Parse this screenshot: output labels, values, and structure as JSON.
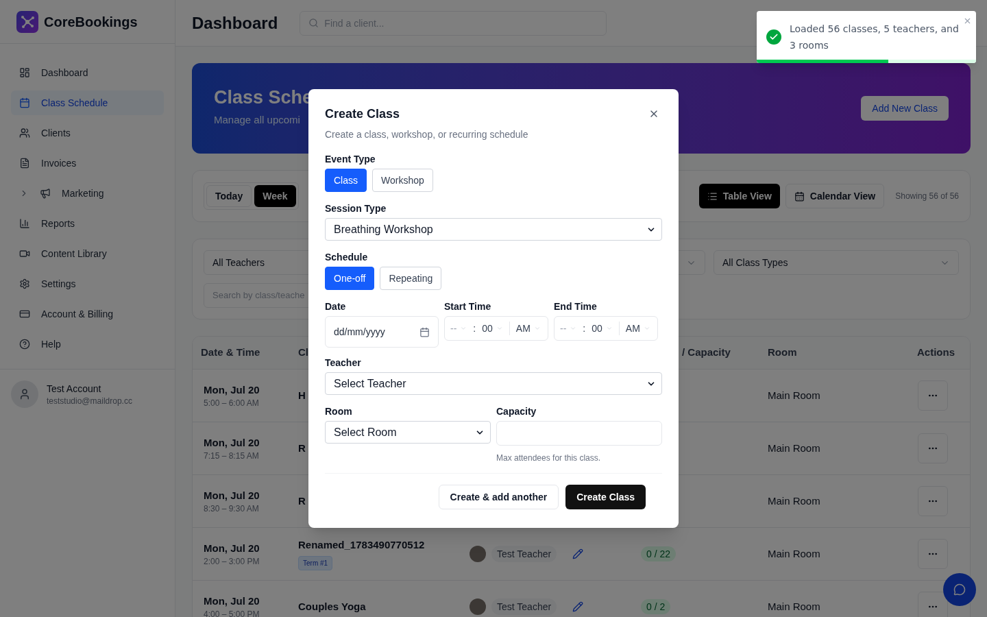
{
  "app": {
    "name": "CoreBookings"
  },
  "sidebar": {
    "items": [
      {
        "label": "Dashboard",
        "selected": false,
        "expandable": false
      },
      {
        "label": "Class Schedule",
        "selected": true,
        "expandable": false
      },
      {
        "label": "Clients",
        "selected": false,
        "expandable": false
      },
      {
        "label": "Invoices",
        "selected": false,
        "expandable": false
      },
      {
        "label": "Marketing",
        "selected": false,
        "expandable": true
      },
      {
        "label": "Reports",
        "selected": false,
        "expandable": false
      },
      {
        "label": "Content Library",
        "selected": false,
        "expandable": false
      },
      {
        "label": "Settings",
        "selected": false,
        "expandable": false
      },
      {
        "label": "Account & Billing",
        "selected": false,
        "expandable": false
      },
      {
        "label": "Help",
        "selected": false,
        "expandable": false
      }
    ],
    "user": {
      "name": "Test Account",
      "email": "teststudio@maildrop.cc"
    }
  },
  "header": {
    "title": "Dashboard",
    "search": {
      "placeholder": "Find a client..."
    }
  },
  "banner": {
    "title": "Class Sche",
    "subtitle": "Manage all upcomi",
    "button": "Add New Class"
  },
  "toolbar": {
    "ranges": [
      {
        "label": "Today",
        "selected": false
      },
      {
        "label": "Week",
        "selected": true
      }
    ],
    "views": [
      {
        "label": "Table View",
        "selected": true
      },
      {
        "label": "Calendar View",
        "selected": false
      }
    ],
    "count": "Showing 56 of 56"
  },
  "filters": {
    "teacher": "All Teachers",
    "class_type": "All Class Types",
    "search": {
      "placeholder": "Search by class/teache"
    }
  },
  "table": {
    "columns": [
      "Date & Time",
      "Cl",
      "/ Capacity",
      "Room",
      "Actions"
    ],
    "rows": [
      {
        "date": "Mon, Jul 20",
        "time": "5:00 – 6:00 AM",
        "class": "H",
        "room": "Main Room"
      },
      {
        "date": "Mon, Jul 20",
        "time": "7:15 – 8:15 AM",
        "class": "R",
        "room": "Main Room"
      },
      {
        "date": "Mon, Jul 20",
        "time": "8:30 – 9:30 AM",
        "class": "R",
        "room": "Main Room"
      },
      {
        "date": "Mon, Jul 20",
        "time": "2:00 – 3:00 PM",
        "class": "Renamed_1783490770512",
        "tag": "Term #1",
        "teacher": "Test Teacher",
        "capacity": "0 / 22",
        "room": "Main Room"
      },
      {
        "date": "Mon, Jul 20",
        "time": "4:00 – 5:00 PM",
        "class": "Couples Yoga",
        "teacher": "Test Teacher",
        "capacity": "0 / 2",
        "room": "Main Room"
      }
    ]
  },
  "dialog": {
    "title": "Create Class",
    "subtitle": "Create a class, workshop, or recurring schedule",
    "event_type": {
      "label": "Event Type",
      "options": [
        {
          "label": "Class",
          "selected": true
        },
        {
          "label": "Workshop",
          "selected": false
        }
      ]
    },
    "session_type": {
      "label": "Session Type",
      "value": "Breathing Workshop"
    },
    "schedule": {
      "label": "Schedule",
      "options": [
        {
          "label": "One-off",
          "selected": true
        },
        {
          "label": "Repeating",
          "selected": false
        }
      ]
    },
    "date": {
      "label": "Date",
      "placeholder": "dd/mm/yyyy"
    },
    "start_time": {
      "label": "Start Time",
      "hour": "--",
      "separator": ":",
      "minute": "00",
      "period": "AM"
    },
    "end_time": {
      "label": "End Time",
      "hour": "--",
      "separator": ":",
      "minute": "00",
      "period": "AM"
    },
    "teacher": {
      "label": "Teacher",
      "value": "Select Teacher"
    },
    "room": {
      "label": "Room",
      "value": "Select Room"
    },
    "capacity": {
      "label": "Capacity",
      "hint": "Max attendees for this class."
    },
    "buttons": [
      "Create & add another",
      "Create Class"
    ]
  },
  "toast": {
    "message": "Loaded 56 classes, 5 teachers, and 3 rooms",
    "level": 0.6
  }
}
